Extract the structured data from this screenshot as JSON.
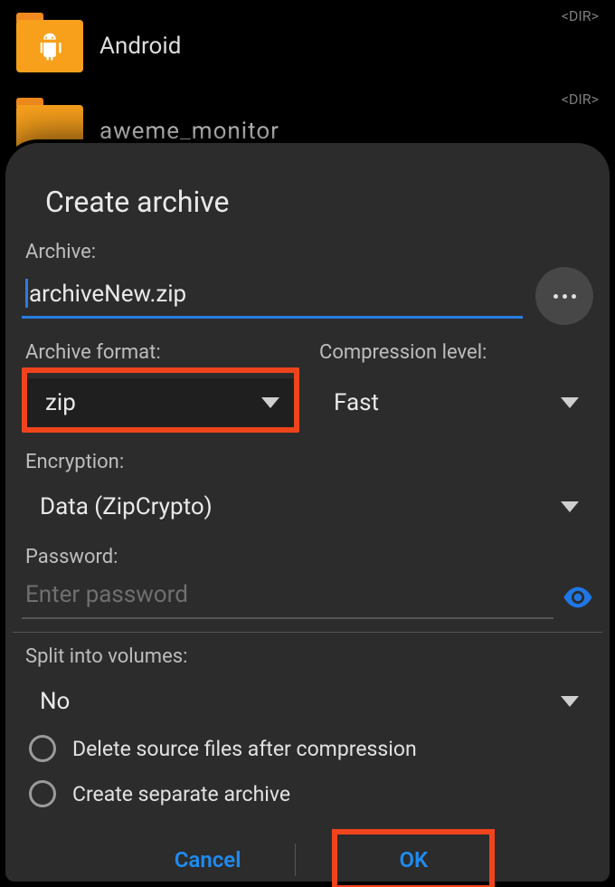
{
  "background": {
    "dir_tag": "<DIR>",
    "items": [
      {
        "name": "Android"
      },
      {
        "name": "aweme_monitor"
      }
    ]
  },
  "dialog": {
    "title": "Create archive",
    "archive_label": "Archive:",
    "archive_name": "archiveNew.zip",
    "format_label": "Archive format:",
    "format_value": "zip",
    "compression_label": "Compression level:",
    "compression_value": "Fast",
    "encryption_label": "Encryption:",
    "encryption_value": "Data (ZipCrypto)",
    "password_label": "Password:",
    "password_placeholder": "Enter password",
    "split_label": "Split into volumes:",
    "split_value": "No",
    "radio_delete": "Delete source files after compression",
    "radio_separate": "Create separate archive",
    "cancel": "Cancel",
    "ok": "OK"
  }
}
